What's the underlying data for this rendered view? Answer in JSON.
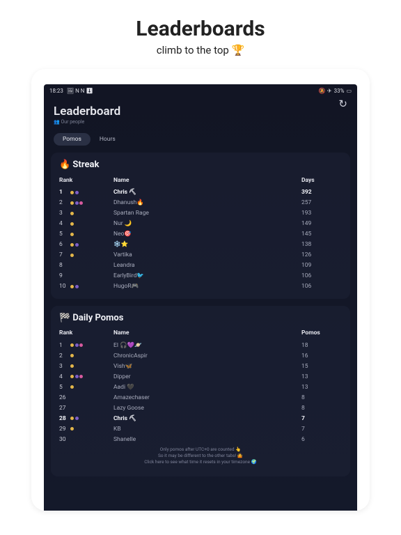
{
  "page": {
    "title": "Leaderboards",
    "subtitle": "climb to the top 🏆"
  },
  "statusbar": {
    "time": "18:23",
    "icons_left": "🖼 N N ⬇",
    "battery": "33%",
    "icons_right": "🔕 ✈"
  },
  "app": {
    "title": "Leaderboard",
    "subtitle": "👥 Our people"
  },
  "tabs": [
    {
      "label": "Pomos",
      "active": true
    },
    {
      "label": "Hours",
      "active": false
    }
  ],
  "streak": {
    "title": "🔥 Streak",
    "headers": {
      "rank": "Rank",
      "name": "Name",
      "value": "Days"
    },
    "rows": [
      {
        "rank": "1",
        "badges": [
          "gold",
          "purple"
        ],
        "name": "Chris ⛏",
        "value": "392",
        "highlight": true
      },
      {
        "rank": "2",
        "badges": [
          "gold",
          "purple",
          "pink"
        ],
        "name": "Dhanush🔥",
        "value": "257"
      },
      {
        "rank": "3",
        "badges": [
          "gold"
        ],
        "name": "Spartan Rage",
        "value": "193"
      },
      {
        "rank": "4",
        "badges": [
          "gold"
        ],
        "name": "Nur 🌙",
        "value": "149"
      },
      {
        "rank": "5",
        "badges": [
          "gold"
        ],
        "name": "Neo🎯",
        "value": "145"
      },
      {
        "rank": "6",
        "badges": [
          "gold",
          "purple"
        ],
        "name": "❄️⭐",
        "value": "138"
      },
      {
        "rank": "7",
        "badges": [
          "gold"
        ],
        "name": "Vartika",
        "value": "126"
      },
      {
        "rank": "8",
        "badges": [],
        "name": "Leandra",
        "value": "109"
      },
      {
        "rank": "9",
        "badges": [],
        "name": "EarlyBird🐦",
        "value": "106"
      },
      {
        "rank": "10",
        "badges": [
          "gold",
          "purple"
        ],
        "name": "HugoR🎮",
        "value": "106"
      }
    ]
  },
  "daily": {
    "title": "🏁 Daily Pomos",
    "headers": {
      "rank": "Rank",
      "name": "Name",
      "value": "Pomos"
    },
    "rows": [
      {
        "rank": "1",
        "badges": [
          "gold",
          "purple",
          "pink"
        ],
        "name": "El 🎧💜🪐",
        "value": "18"
      },
      {
        "rank": "2",
        "badges": [
          "gold"
        ],
        "name": "ChronicAspir",
        "value": "16"
      },
      {
        "rank": "3",
        "badges": [
          "gold"
        ],
        "name": "Vish🦋",
        "value": "15"
      },
      {
        "rank": "4",
        "badges": [
          "gold",
          "purple",
          "pink"
        ],
        "name": "Dipper",
        "value": "13"
      },
      {
        "rank": "5",
        "badges": [
          "gold"
        ],
        "name": "Aadi 🖤",
        "value": "13"
      },
      {
        "rank": "26",
        "badges": [],
        "name": "Amazechaser",
        "value": "8"
      },
      {
        "rank": "27",
        "badges": [],
        "name": "Lazy Goose",
        "value": "8"
      },
      {
        "rank": "28",
        "badges": [
          "gold",
          "purple"
        ],
        "name": "Chris ⛏",
        "value": "7",
        "highlight": true
      },
      {
        "rank": "29",
        "badges": [
          "gold"
        ],
        "name": "KB",
        "value": "7"
      },
      {
        "rank": "30",
        "badges": [],
        "name": "Shanelle",
        "value": "6"
      }
    ],
    "footnote1": "Only pomos after UTC+0 are counted 👆",
    "footnote2": "So it may be different to the other tabs! 🤷",
    "footnote3": "Click here to see what time it resets in your timezone 🌍"
  }
}
